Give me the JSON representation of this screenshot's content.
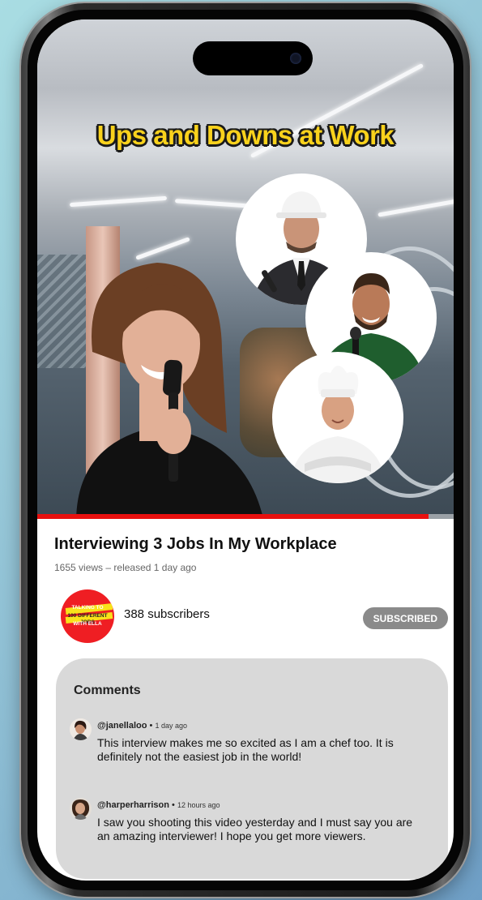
{
  "video": {
    "thumbnail_title": "Ups and Downs at Work",
    "title": "Interviewing 3 Jobs In My Workplace",
    "views": "1655 views",
    "released": "released 1 day ago",
    "progress_fraction": 0.94
  },
  "channel": {
    "avatar_text": [
      "TALKING TO",
      "100 DIFFERENT JOBS",
      "WITH ELLA"
    ],
    "subscribers": "388 subscribers",
    "subscribe_label": "SUBSCRIBED"
  },
  "comments": {
    "heading": "Comments",
    "items": [
      {
        "user": "@janellaloo",
        "time": "1 day ago",
        "text": "This interview makes me so excited as I am a chef too. It is definitely not the easiest job in the world!"
      },
      {
        "user": "@harperharrison",
        "time": "12 hours ago",
        "text": "I saw you shooting this video yesterday and I must say you are an amazing interviewer! I hope you get more viewers."
      }
    ]
  },
  "colors": {
    "progress": "#e8100f",
    "title_yellow": "#f9d21c",
    "avatar_red": "#ef1e23",
    "comments_bg": "#d9d9d9",
    "button_gray": "#8a8a8a"
  }
}
